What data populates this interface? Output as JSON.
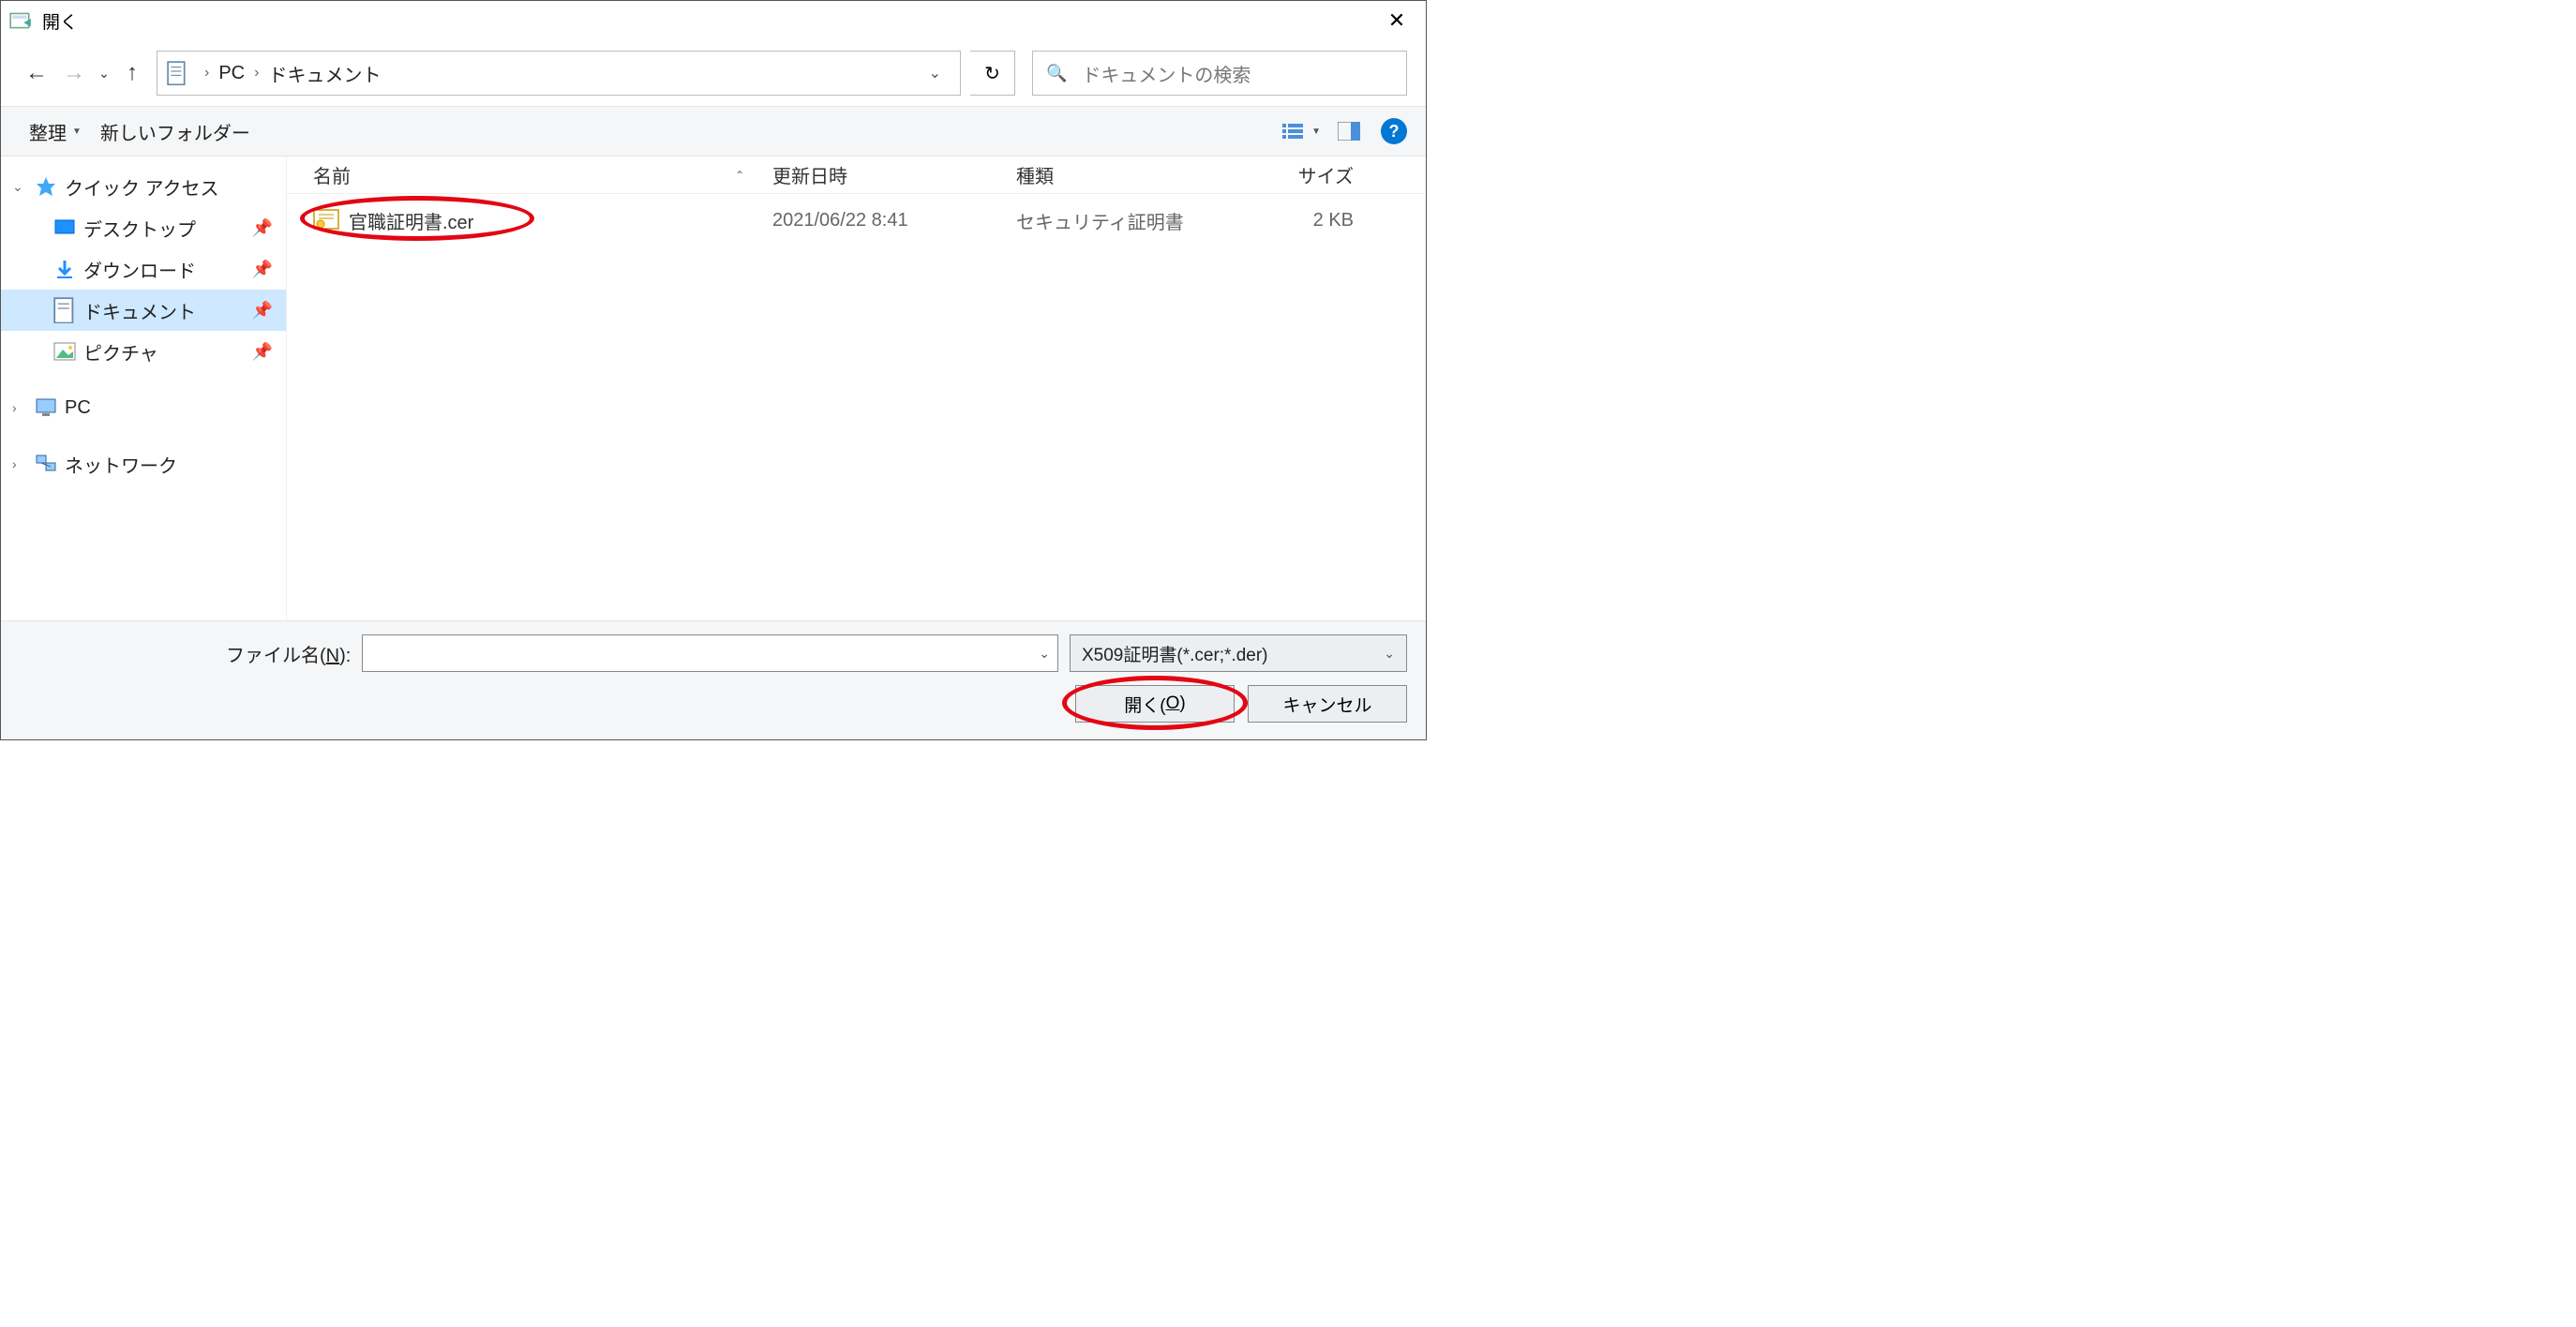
{
  "title": "開く",
  "breadcrumb": {
    "root": "PC",
    "folder": "ドキュメント"
  },
  "search_placeholder": "ドキュメントの検索",
  "toolbar": {
    "organize": "整理",
    "new_folder": "新しいフォルダー"
  },
  "sidebar": {
    "quick_access": "クイック アクセス",
    "desktop": "デスクトップ",
    "downloads": "ダウンロード",
    "documents": "ドキュメント",
    "pictures": "ピクチャ",
    "pc": "PC",
    "network": "ネットワーク"
  },
  "columns": {
    "name": "名前",
    "date": "更新日時",
    "type": "種類",
    "size": "サイズ"
  },
  "files": [
    {
      "name": "官職証明書.cer",
      "date": "2021/06/22 8:41",
      "type": "セキュリティ証明書",
      "size": "2 KB"
    }
  ],
  "footer": {
    "filename_label_pre": "ファイル名(",
    "filename_label_u": "N",
    "filename_label_post": "):",
    "filter": "X509証明書(*.cer;*.der)",
    "open_pre": "開く(",
    "open_u": "O",
    "open_post": ")",
    "cancel": "キャンセル"
  }
}
